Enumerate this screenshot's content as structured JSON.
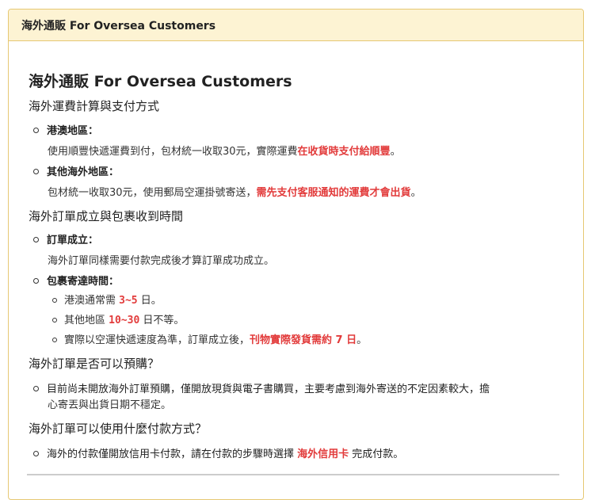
{
  "header": {
    "title": "海外通販 For Oversea Customers"
  },
  "main": {
    "title": "海外通販 For Oversea Customers",
    "shipping": {
      "heading": "海外運費計算與支付方式",
      "hk_macau": {
        "label": "港澳地區：",
        "desc_prefix": "使用順豐快遞運費到付，包材統一收取30元，實際運費",
        "desc_highlight": "在收貨時支付給順豐",
        "desc_suffix": "。"
      },
      "other": {
        "label": "其他海外地區：",
        "desc_prefix": "包材統一收取30元，使用郵局空運掛號寄送，",
        "desc_highlight": "需先支付客服通知的運費才會出貨",
        "desc_suffix": "。"
      }
    },
    "order_time": {
      "heading": "海外訂單成立與包裹收到時間",
      "established": {
        "label": "訂單成立：",
        "desc": "海外訂單同樣需要付款完成後才算訂單成功成立。"
      },
      "delivery": {
        "label": "包裹寄達時間：",
        "items": [
          {
            "prefix": "港澳通常需 ",
            "highlight": "3~5",
            "suffix": " 日。"
          },
          {
            "prefix": "其他地區 ",
            "highlight": "10~30",
            "suffix": " 日不等。"
          },
          {
            "prefix": "實際以空運快遞速度為準，訂單成立後，",
            "highlight": "刊物實際發貨需約 7 日",
            "suffix": "。"
          }
        ]
      }
    },
    "preorder": {
      "heading": "海外訂單是否可以預購？",
      "line1": "目前尚未開放海外訂單預購，僅開放現貨與電子書購買，主要考慮到海外寄送的不定因素較大，擔",
      "line2": "心寄丟與出貨日期不穩定。"
    },
    "payment": {
      "heading": "海外訂單可以使用什麼付款方式？",
      "prefix": "海外的付款僅開放信用卡付款，請在付款的步驟時選擇 ",
      "highlight": "海外信用卡",
      "suffix": " 完成付款。"
    }
  }
}
